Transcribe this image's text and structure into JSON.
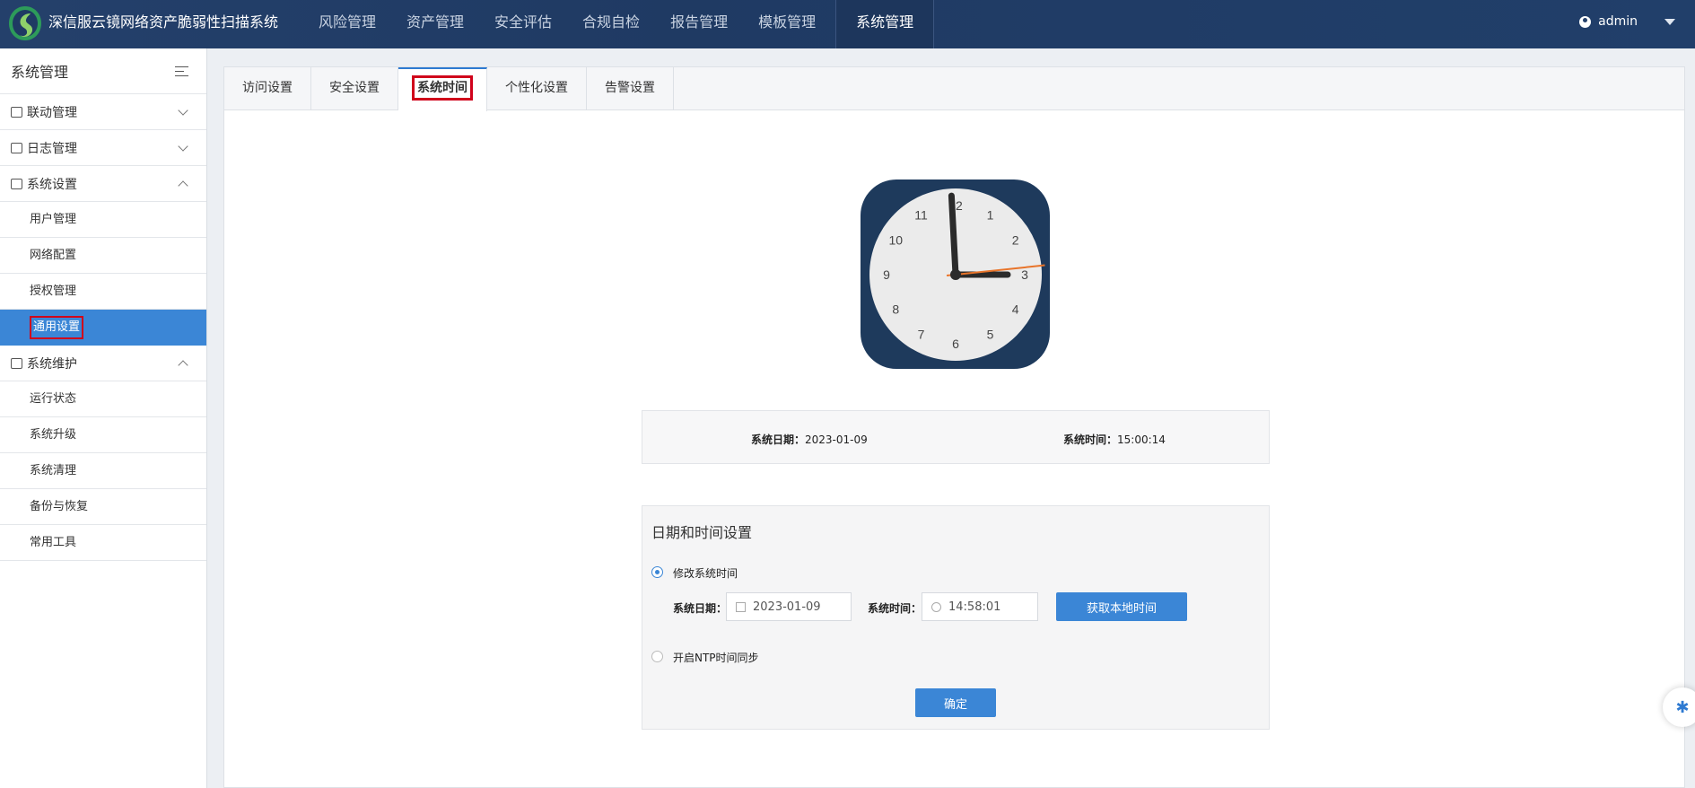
{
  "app": {
    "title": "深信服云镜网络资产脆弱性扫描系统"
  },
  "nav": {
    "items": [
      "风险管理",
      "资产管理",
      "安全评估",
      "合规自检",
      "报告管理",
      "模板管理",
      "系统管理"
    ],
    "active": "系统管理"
  },
  "user": {
    "name": "admin"
  },
  "sidebar": {
    "title": "系统管理",
    "groups": [
      {
        "label": "联动管理",
        "icon": "link-icon",
        "expanded": false
      },
      {
        "label": "日志管理",
        "icon": "log-icon",
        "expanded": false
      },
      {
        "label": "系统设置",
        "icon": "grid-icon",
        "expanded": true,
        "items": [
          "用户管理",
          "网络配置",
          "授权管理",
          "通用设置"
        ]
      },
      {
        "label": "系统维护",
        "icon": "tools-icon",
        "expanded": true,
        "items": [
          "运行状态",
          "系统升级",
          "系统清理",
          "备份与恢复",
          "常用工具"
        ]
      }
    ],
    "active_item": "通用设置"
  },
  "tabs": {
    "items": [
      "访问设置",
      "安全设置",
      "系统时间",
      "个性化设置",
      "告警设置"
    ],
    "active": "系统时间"
  },
  "clock": {
    "numbers": [
      "12",
      "1",
      "2",
      "3",
      "4",
      "5",
      "6",
      "7",
      "8",
      "9",
      "10",
      "11"
    ],
    "hour_hand_deg": 90,
    "minute_hand_deg": -3,
    "second_hand_deg": 84,
    "colors": {
      "frame": "#1e3a5c",
      "face": "#ebebeb",
      "hands": "#2b2b2b",
      "second": "#e8742a"
    }
  },
  "system_info": {
    "date_label": "系统日期：",
    "date_value": "2023-01-09",
    "time_label": "系统时间：",
    "time_value": "15:00:14"
  },
  "settings": {
    "heading": "日期和时间设置",
    "option_manual": "修改系统时间",
    "option_ntp": "开启NTP时间同步",
    "date_label": "系统日期：",
    "date_value": "2023-01-09",
    "time_label": "系统时间：",
    "time_value": "14:58:01",
    "get_local_button": "获取本地时间",
    "confirm_button": "确定"
  },
  "colors": {
    "accent": "#3b86d6",
    "topbar": "#24406b",
    "highlight": "#d0021b"
  }
}
